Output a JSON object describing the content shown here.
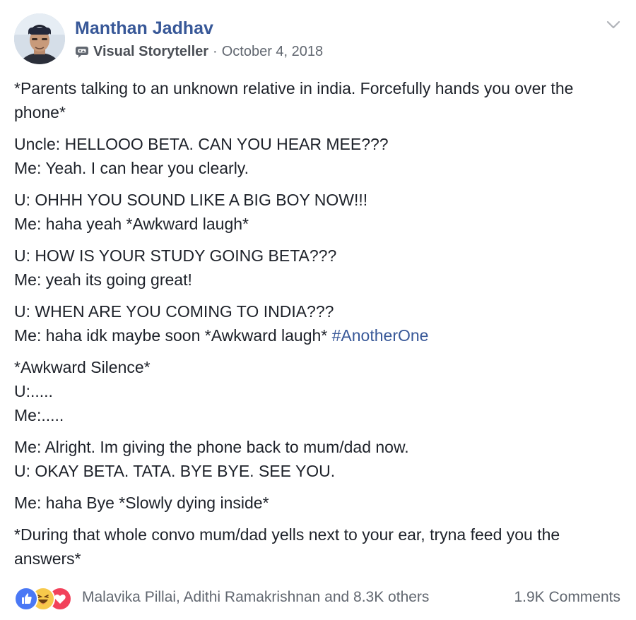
{
  "post": {
    "author": {
      "name": "Manthan Jadhav",
      "badge_icon": "storyteller-icon",
      "badge": "Visual Storyteller",
      "separator": "·",
      "date": "October 4, 2018"
    },
    "options_icon": "chevron-down-icon",
    "paragraphs": [
      [
        "*Parents talking to an unknown relative in india. Forcefully hands you over the phone*"
      ],
      [
        "Uncle: HELLOOO BETA. CAN YOU HEAR MEE???",
        "Me: Yeah. I can hear you clearly."
      ],
      [
        "U: OHHH YOU SOUND LIKE A BIG BOY NOW!!!",
        "Me: haha yeah *Awkward laugh*"
      ],
      [
        "U: HOW IS YOUR STUDY GOING BETA???",
        "Me: yeah its going great!"
      ],
      [
        "U: WHEN ARE YOU COMING TO INDIA???",
        "Me: haha idk maybe soon *Awkward laugh* "
      ],
      [
        "*Awkward Silence*",
        "U:.....",
        "Me:....."
      ],
      [
        "Me: Alright. Im giving the phone back to mum/dad now.",
        "U: OKAY BETA. TATA. BYE BYE. SEE YOU."
      ],
      [
        "Me: haha Bye *Slowly dying inside*"
      ],
      [
        "*During that whole convo mum/dad yells next to your ear, tryna feed you the answers*"
      ]
    ],
    "hashtag": "#AnotherOne",
    "footer": {
      "reaction_icons": [
        "like-icon",
        "haha-icon",
        "love-icon"
      ],
      "reactors": "Malavika Pillai, Adithi Ramakrishnan and 8.3K others",
      "comments": "1.9K Comments"
    },
    "colors": {
      "link": "#385898",
      "text": "#1d2129",
      "meta": "#616770",
      "like": "#4a78f5",
      "haha": "#f7c94b",
      "love": "#f2415a"
    }
  }
}
